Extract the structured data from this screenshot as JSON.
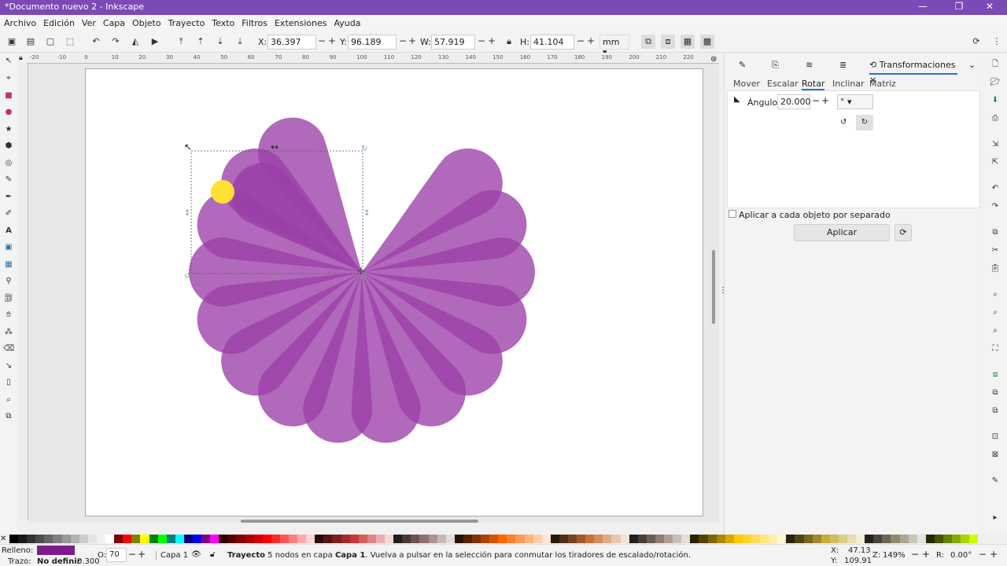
{
  "window": {
    "title": "*Documento nuevo 2 - Inkscape",
    "minimize": "—",
    "maximize": "❐",
    "close": "✕"
  },
  "menu": [
    "Archivo",
    "Edición",
    "Ver",
    "Capa",
    "Objeto",
    "Trayecto",
    "Texto",
    "Filtros",
    "Extensiones",
    "Ayuda"
  ],
  "toolbar": {
    "x_label": "X:",
    "x_value": "36.397",
    "y_label": "Y:",
    "y_value": "96.189",
    "w_label": "W:",
    "w_value": "57.919",
    "h_label": "H:",
    "h_value": "41.104",
    "unit": "mm"
  },
  "ruler": [
    "-20",
    "-10",
    "0",
    "10",
    "20",
    "30",
    "40",
    "50",
    "60",
    "70",
    "80",
    "90",
    "100",
    "110",
    "120",
    "130",
    "140",
    "150",
    "160",
    "170",
    "180",
    "190",
    "200",
    "210",
    "220"
  ],
  "panel": {
    "tab_title": "Transformaciones",
    "subtabs": [
      "Mover",
      "Escalar",
      "Rotar",
      "Inclinar",
      "Matriz"
    ],
    "active_subtab": "Rotar",
    "angle_label": "Ángulo:",
    "angle_value": "20.000",
    "angle_unit": "°",
    "apply_each_label": "Aplicar a cada objeto por separado",
    "apply_label": "Aplicar"
  },
  "colors": {
    "petal": "#9b3fa8",
    "petal_overlap": "#7d1a8c",
    "dot": "#ffe135",
    "titlebar": "#7b4ab6"
  },
  "status": {
    "fill_label": "Relleno:",
    "stroke_label": "Trazo:",
    "stroke_value": "No definir",
    "stroke_width": "0.300",
    "opacity_label": "O:",
    "opacity_value": "70",
    "layer": "Capa 1",
    "message_bold": "Trayecto",
    "message_mid": " 5 nodos en capa ",
    "message_layer": "Capa 1",
    "message_rest": ". Vuelva a pulsar en la selección para conmutar los tiradores de escalado/rotación.",
    "cursor_x_label": "X:",
    "cursor_x": "47.13",
    "cursor_y_label": "Y:",
    "cursor_y": "109.91",
    "zoom_label": "Z:",
    "zoom": "149%",
    "rotation_label": "R:",
    "rotation": "0.00°"
  }
}
